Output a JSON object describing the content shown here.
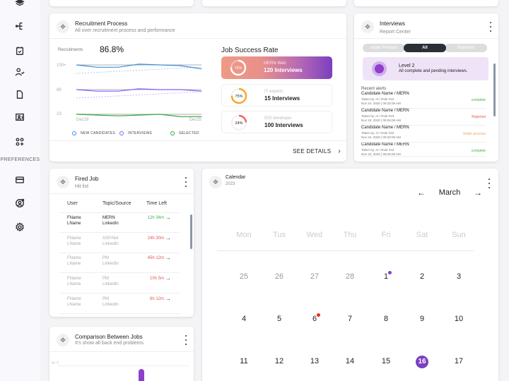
{
  "sidebar": {
    "items": [
      {
        "icon": "layers-icon"
      },
      {
        "icon": "hierarchy-icon"
      },
      {
        "icon": "calendar-check-icon"
      },
      {
        "icon": "user-check-icon"
      },
      {
        "icon": "document-icon"
      },
      {
        "icon": "user-board-icon"
      },
      {
        "icon": "apps-add-icon"
      }
    ],
    "section_label": "PREFERENCES",
    "pref_items": [
      {
        "icon": "credit-card-icon"
      },
      {
        "icon": "user-settings-icon"
      },
      {
        "icon": "gear-icon"
      }
    ]
  },
  "recruitment": {
    "title": "Recruitment Process",
    "subtitle": "All over recruitment process and performance",
    "metric_label": "Recruitments",
    "metric_value": "86.8%",
    "see_details": "SEE DETAILS",
    "chart_data": {
      "type": "line",
      "x": [
        "Dec19",
        "Dec20",
        "Dec21",
        "Dec22",
        "Dec23",
        "Dec24",
        "Dec25"
      ],
      "x_tick_labels": [
        "Dec19",
        "Dec25"
      ],
      "y_tick_labels": [
        "100+",
        "89",
        "23"
      ],
      "series": [
        {
          "name": "NEW CANDIDATES",
          "color": "#3b8fe0",
          "values": [
            100,
            97,
            97,
            101,
            100,
            99,
            95
          ]
        },
        {
          "name": "INTERVIEWS",
          "color": "#8b5cf6",
          "values": [
            89,
            87,
            87,
            90,
            89,
            89,
            87
          ]
        },
        {
          "name": "SELECTED",
          "color": "#2eaa3c",
          "values": [
            23,
            22,
            21,
            22,
            23,
            20,
            20
          ]
        }
      ],
      "legend": "bottom",
      "grid": true
    },
    "legend": [
      {
        "label": "NEW CANDIDATES",
        "color": "#3b8fe0"
      },
      {
        "label": "INTERVIEWS",
        "color": "#8b5cf6"
      },
      {
        "label": "SELECTED",
        "color": "#2eaa3c"
      }
    ]
  },
  "job_success": {
    "title": "Job Success Rate",
    "jobs": [
      {
        "category": "MERN Web",
        "count": "120 Interviews",
        "percent": 75,
        "percent_label": "75%",
        "color": "#ffffff",
        "active": true
      },
      {
        "category": "IT experts",
        "count": "15 Interviews",
        "percent": 75,
        "percent_label": "75%",
        "color": "#f5a623",
        "active": false
      },
      {
        "category": "IOS developer",
        "count": "100 Interviews",
        "percent": 24,
        "percent_label": "24%",
        "color": "#ef6461",
        "active": false
      }
    ]
  },
  "interviews": {
    "title": "Interviews",
    "subtitle": "Report Center",
    "tabs": [
      "under Process",
      "All",
      "Rejected"
    ],
    "active_tab": "All",
    "level_title": "Level 2",
    "level_desc": "All complete and pending interviews.",
    "alerts_label": "Recent alerts",
    "alerts": [
      {
        "name": "Candidate Name / MERN",
        "by": "Taken by: AI / Rule #23",
        "date": "Nov 24, 2020 | 09:26:08 AM",
        "status": "complete",
        "color": "#3cb44b"
      },
      {
        "name": "Candidate Name / MERN",
        "by": "Taken by: AI / Rule #23",
        "date": "Nov 24, 2020 | 09:26:08 AM",
        "status": "Rejected",
        "color": "#e05a4e"
      },
      {
        "name": "Candidate Name / MERN",
        "by": "Taken by: AI / Rule #23",
        "date": "Nov 24, 2020 | 09:26:08 AM",
        "status": "Under process",
        "color": "#f5a25d"
      },
      {
        "name": "Candidate Name / MERN",
        "by": "Taken by: AI / Rule #23",
        "date": "Nov 24, 2020 | 09:26:08 AM",
        "status": "complete",
        "color": "#3cb44b"
      }
    ]
  },
  "fired_job": {
    "title": "Fired Job",
    "subtitle": "Hit list",
    "columns": [
      "User",
      "Topic/Source",
      "Time Left"
    ],
    "rows": [
      {
        "first": "FName",
        "last": "LName",
        "topic": "MERN",
        "source": "LinkedIn",
        "time": "12h 34m",
        "color": "#3cb44b",
        "highlight": true
      },
      {
        "first": "FName",
        "last": "LName",
        "topic": "ASP.Net",
        "source": "LinkedIn",
        "time": "24h 30m",
        "color": "#e05a4e",
        "highlight": false
      },
      {
        "first": "FName",
        "last": "LName",
        "topic": "PM",
        "source": "LinkedIn",
        "time": "45h 12m",
        "color": "#e05a4e",
        "highlight": false
      },
      {
        "first": "FName",
        "last": "LName",
        "topic": "PM",
        "source": "LinkedIn",
        "time": "10h 5m",
        "color": "#e05a4e",
        "highlight": false
      },
      {
        "first": "FName",
        "last": "LName",
        "topic": "PM",
        "source": "LinkedIn",
        "time": "6h 12m",
        "color": "#e05a4e",
        "highlight": false
      }
    ],
    "arrow": "→"
  },
  "comparison": {
    "title": "Comparison Between Jobs",
    "subtitle": "It's show all back end problems",
    "y_label": "5+ Y"
  },
  "calendar": {
    "title": "Calendar",
    "year": "2023",
    "month": "March",
    "prev": "←",
    "next": "→",
    "weekdays": [
      "Mon",
      "Tus",
      "Wed",
      "Thu",
      "Fri",
      "Sat",
      "Sun"
    ],
    "weeks": [
      [
        {
          "d": "25",
          "muted": true
        },
        {
          "d": "26",
          "muted": true
        },
        {
          "d": "27",
          "muted": true
        },
        {
          "d": "28",
          "muted": true
        },
        {
          "d": "1",
          "dot": "#8e3fcc"
        },
        {
          "d": "2"
        },
        {
          "d": "3"
        }
      ],
      [
        {
          "d": "4"
        },
        {
          "d": "5"
        },
        {
          "d": "6",
          "dot": "#f02a1e"
        },
        {
          "d": "7"
        },
        {
          "d": "8"
        },
        {
          "d": "9"
        },
        {
          "d": "10"
        }
      ],
      [
        {
          "d": "11"
        },
        {
          "d": "12"
        },
        {
          "d": "13"
        },
        {
          "d": "14"
        },
        {
          "d": "15"
        },
        {
          "d": "16",
          "selected": true
        },
        {
          "d": "17"
        }
      ]
    ]
  }
}
